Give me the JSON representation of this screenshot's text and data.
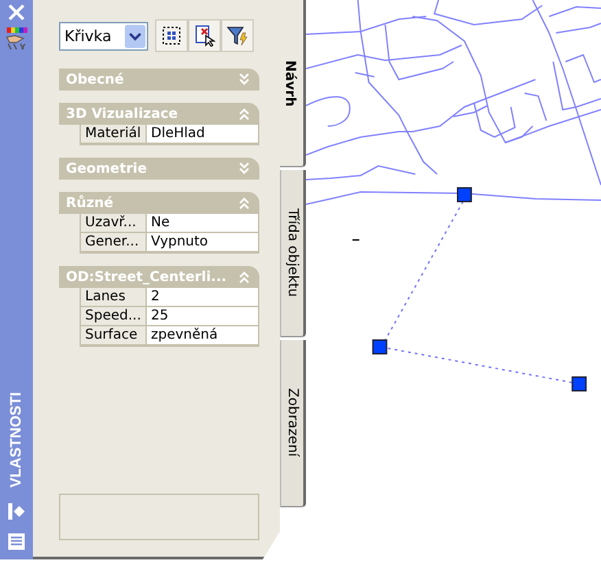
{
  "dock": {
    "title": "VLASTNOSTI"
  },
  "selector": {
    "value": "Křivka"
  },
  "categories": [
    {
      "title": "Obecné",
      "expanded": false
    },
    {
      "title": "3D Vizualizace",
      "expanded": true,
      "rows": [
        {
          "name": "Materiál",
          "value": "DleHlad"
        }
      ]
    },
    {
      "title": "Geometrie",
      "expanded": false
    },
    {
      "title": "Různé",
      "expanded": true,
      "rows": [
        {
          "name": "Uzavř...",
          "value": "Ne"
        },
        {
          "name": "Gener...",
          "value": "Vypnuto"
        }
      ]
    },
    {
      "title": "OD:Street_Centerli...",
      "expanded": true,
      "rows": [
        {
          "name": "Lanes",
          "value": "2"
        },
        {
          "name": "Speed...",
          "value": "25"
        },
        {
          "name": "Surface",
          "value": "zpevněná"
        }
      ]
    }
  ],
  "tabs": [
    {
      "label": "Návrh",
      "selected": true
    },
    {
      "label": "Třída objektu",
      "selected": false
    },
    {
      "label": "Zobrazení",
      "selected": false
    }
  ]
}
